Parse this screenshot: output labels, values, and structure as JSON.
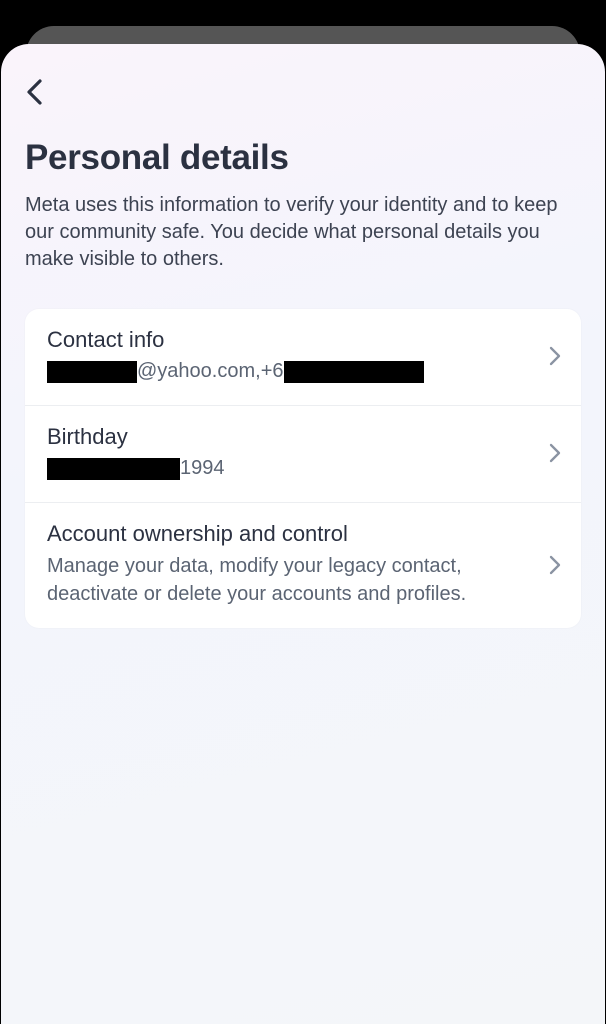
{
  "header": {
    "title": "Personal details",
    "description": "Meta uses this information to verify your identity and to keep our community safe. You decide what personal details you make visible to others."
  },
  "items": [
    {
      "title": "Contact info",
      "emailDomain": "@yahoo.com, ",
      "phonePrefix": "+6"
    },
    {
      "title": "Birthday",
      "yearSuffix": " 1994"
    },
    {
      "title": "Account ownership and control",
      "description": "Manage your data, modify your legacy contact, deactivate or delete your accounts and profiles."
    }
  ]
}
